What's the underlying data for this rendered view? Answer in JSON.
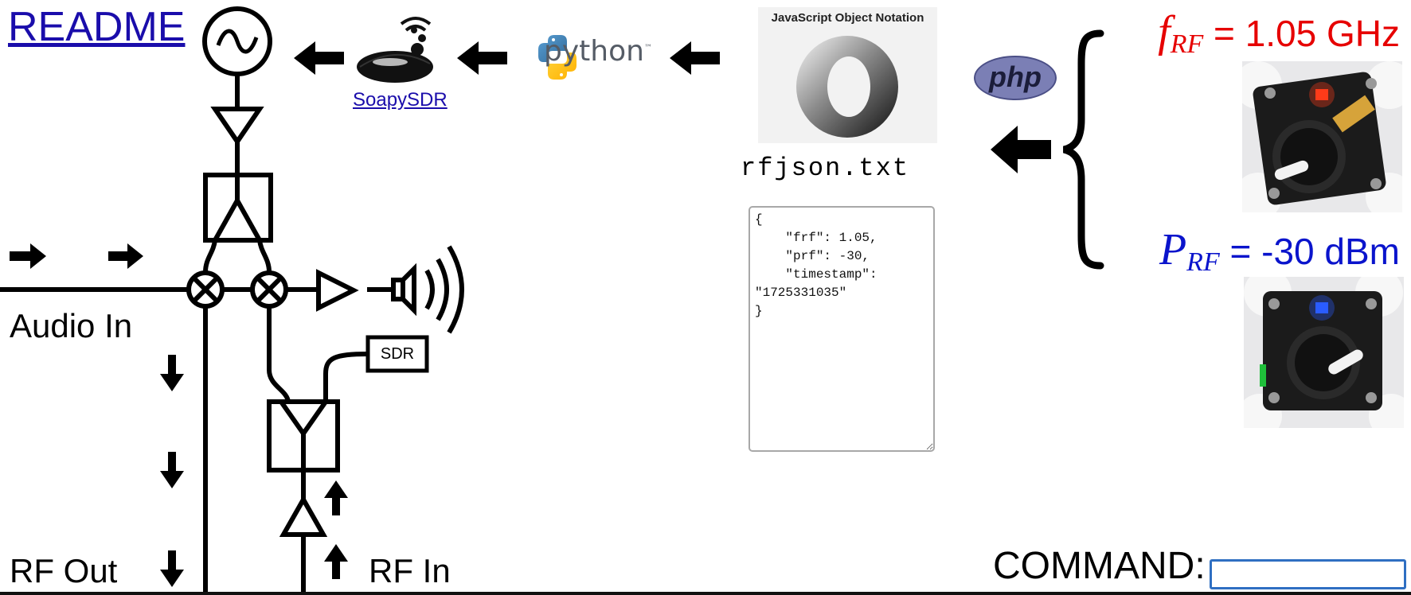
{
  "links": {
    "readme": "README",
    "soapysdr": "SoapySDR"
  },
  "labels": {
    "audio_in": "Audio In",
    "rf_out": "RF Out",
    "rf_in": "RF In",
    "sdr_block": "SDR"
  },
  "logos": {
    "python_word": "python",
    "python_tm": "™",
    "php_word": "php",
    "json_title": "JavaScript Object Notation"
  },
  "json_file": {
    "filename": "rfjson.txt",
    "content": "{\n    \"frf\": 1.05,\n    \"prf\": -30,\n    \"timestamp\": \"1725331035\"\n}"
  },
  "rf_params": {
    "freq_symbol": "f",
    "freq_subscript": "RF",
    "freq_value": "= 1.05 GHz",
    "power_symbol": "P",
    "power_subscript": "RF",
    "power_value": "= -30 dBm"
  },
  "command": {
    "label": "COMMAND:",
    "value": ""
  },
  "encoder_colors": {
    "freq_led": "#ff3b1a",
    "power_led": "#2a5cff"
  },
  "icons": [
    "signal-generator-icon",
    "soapysdr-logo-icon",
    "python-logo-icon",
    "json-logo-icon",
    "php-logo-icon",
    "mixer-icon",
    "amplifier-icon",
    "speaker-icon",
    "left-arrow-icon",
    "right-arrow-icon",
    "down-arrow-icon",
    "up-arrow-icon",
    "curly-brace-icon"
  ]
}
